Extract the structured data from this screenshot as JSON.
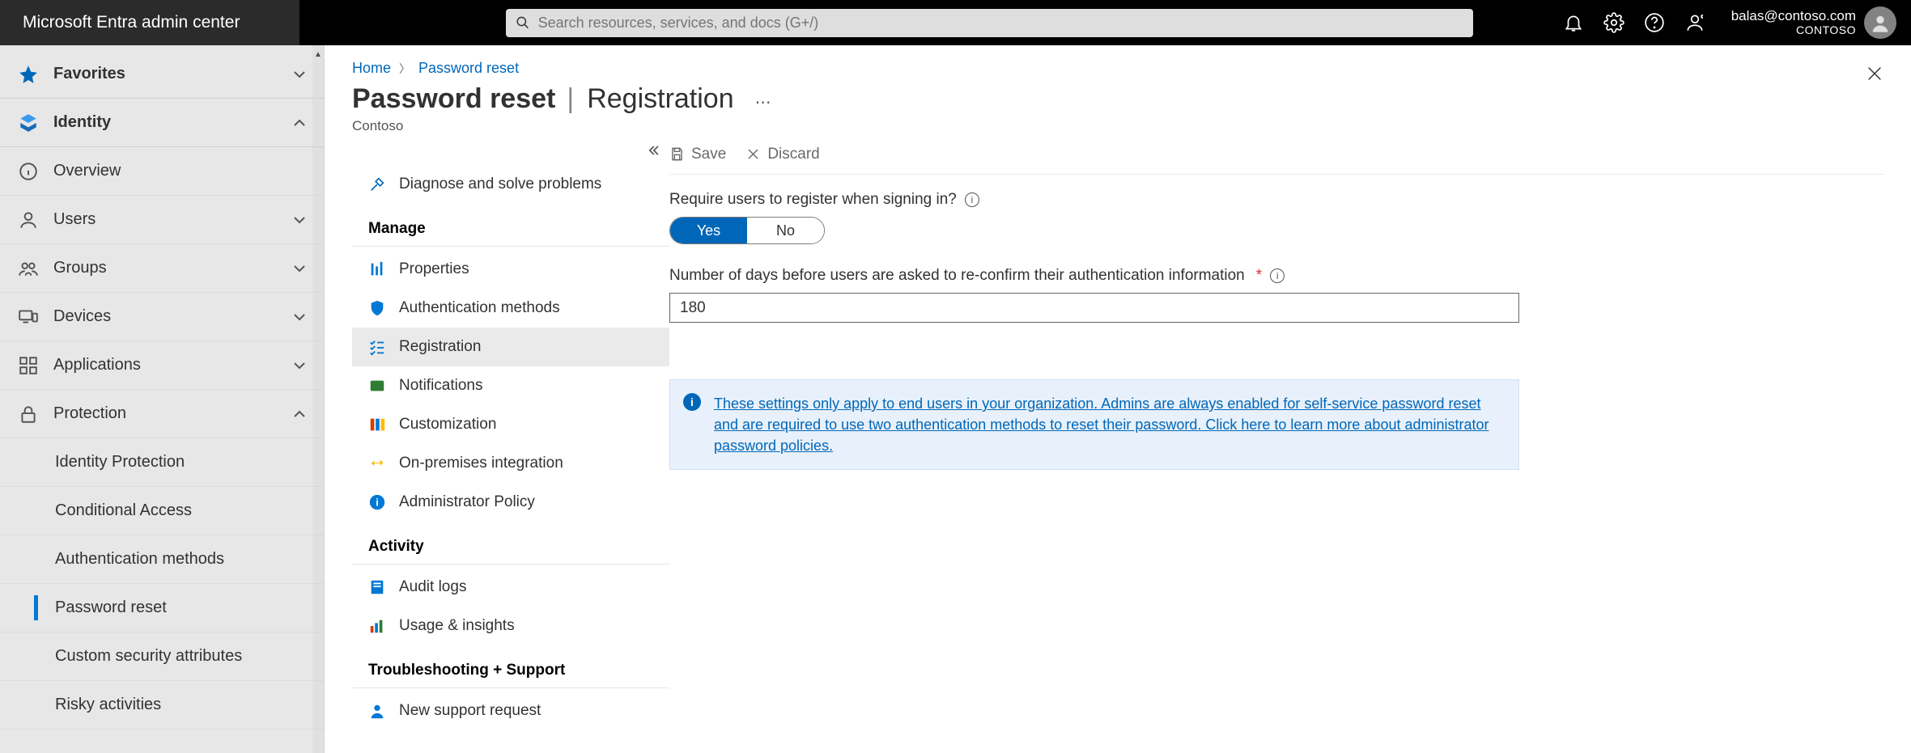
{
  "brand": "Microsoft Entra admin center",
  "search": {
    "placeholder": "Search resources, services, and docs (G+/)"
  },
  "account": {
    "email": "balas@contoso.com",
    "org": "CONTOSO"
  },
  "sidebar": {
    "favorites": "Favorites",
    "identity": "Identity",
    "items": [
      {
        "label": "Overview"
      },
      {
        "label": "Users"
      },
      {
        "label": "Groups"
      },
      {
        "label": "Devices"
      },
      {
        "label": "Applications"
      },
      {
        "label": "Protection"
      }
    ],
    "protection_children": [
      {
        "label": "Identity Protection"
      },
      {
        "label": "Conditional Access"
      },
      {
        "label": "Authentication methods"
      },
      {
        "label": "Password reset"
      },
      {
        "label": "Custom security attributes"
      },
      {
        "label": "Risky activities"
      }
    ]
  },
  "subnav": {
    "diagnose": "Diagnose and solve problems",
    "manage_header": "Manage",
    "manage": [
      {
        "label": "Properties"
      },
      {
        "label": "Authentication methods"
      },
      {
        "label": "Registration"
      },
      {
        "label": "Notifications"
      },
      {
        "label": "Customization"
      },
      {
        "label": "On-premises integration"
      },
      {
        "label": "Administrator Policy"
      }
    ],
    "activity_header": "Activity",
    "activity": [
      {
        "label": "Audit logs"
      },
      {
        "label": "Usage & insights"
      }
    ],
    "trouble_header": "Troubleshooting + Support",
    "trouble": [
      {
        "label": "New support request"
      }
    ]
  },
  "breadcrumb": {
    "home": "Home",
    "current": "Password reset"
  },
  "page": {
    "title": "Password reset",
    "subtitle": "Registration",
    "org": "Contoso"
  },
  "toolbar": {
    "save": "Save",
    "discard": "Discard"
  },
  "form": {
    "require_label": "Require users to register when signing in?",
    "yes": "Yes",
    "no": "No",
    "days_label": "Number of days before users are asked to re-confirm their authentication information",
    "days_value": "180",
    "banner": "These settings only apply to end users in your organization. Admins are always enabled for self-service password reset and are required to use two authentication methods to reset their password. Click here to learn more about administrator password policies."
  }
}
